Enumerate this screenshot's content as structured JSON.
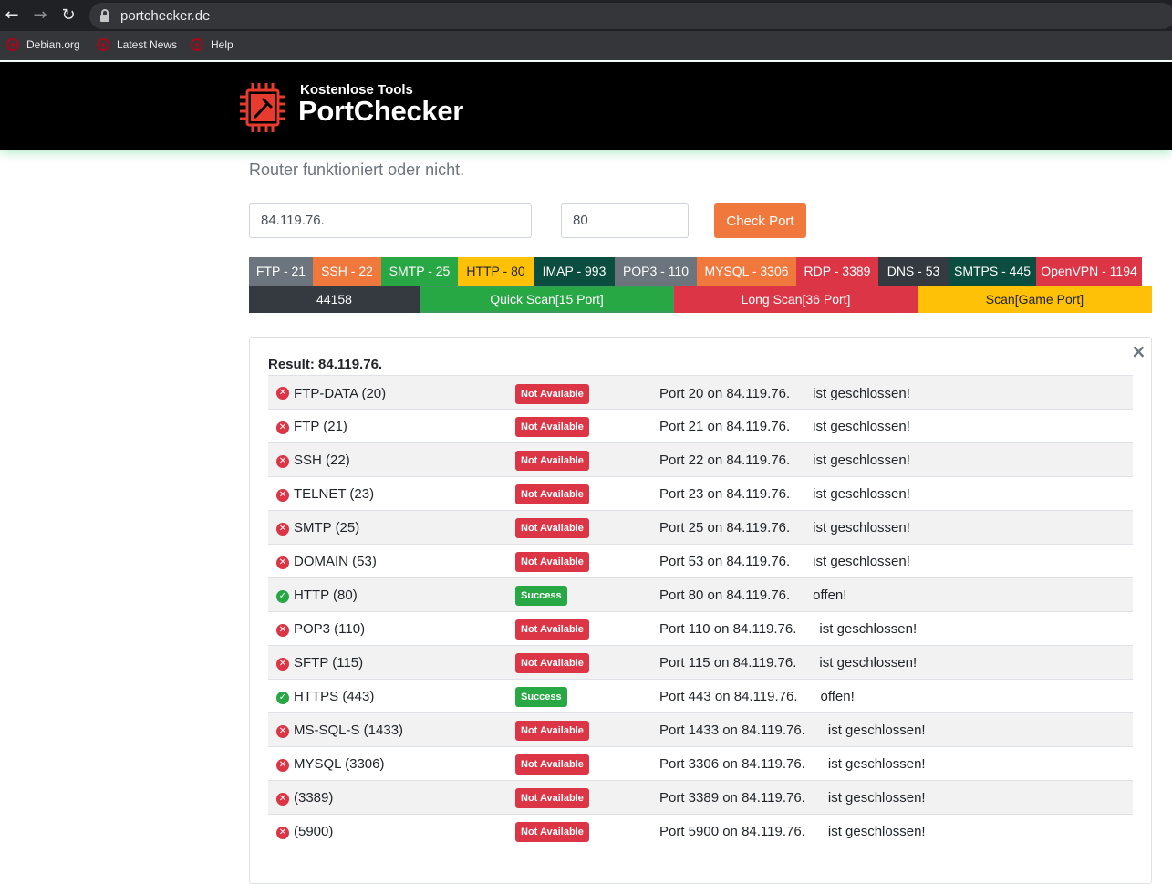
{
  "browser": {
    "url": "portchecker.de",
    "bookmarks": [
      {
        "label": "Debian.org"
      },
      {
        "label": "Latest News"
      },
      {
        "label": "Help"
      }
    ]
  },
  "header": {
    "logo_small": "Kostenlose Tools",
    "logo_big": "PortChecker"
  },
  "intro": {
    "line2": "Router funktioniert oder nicht."
  },
  "form": {
    "ip_value": "84.119.76.",
    "port_value": "80",
    "check_label": "Check Port"
  },
  "quick_ports": [
    {
      "label": "FTP - 21",
      "color": "#6c757d",
      "text": "#ffffff"
    },
    {
      "label": "SSH - 22",
      "color": "#f0783c",
      "text": "#ffffff"
    },
    {
      "label": "SMTP - 25",
      "color": "#28a745",
      "text": "#ffffff"
    },
    {
      "label": "HTTP - 80",
      "color": "#ffc107",
      "text": "#212529"
    },
    {
      "label": "IMAP - 993",
      "color": "#0b4d3f",
      "text": "#ffffff"
    },
    {
      "label": "POP3 - 110",
      "color": "#6c757d",
      "text": "#ffffff"
    },
    {
      "label": "MYSQL - 3306",
      "color": "#f0783c",
      "text": "#ffffff"
    },
    {
      "label": "RDP - 3389",
      "color": "#dc3545",
      "text": "#ffffff"
    },
    {
      "label": "DNS - 53",
      "color": "#343a40",
      "text": "#ffffff"
    },
    {
      "label": "SMTPS - 445",
      "color": "#0b4d3f",
      "text": "#ffffff"
    },
    {
      "label": "OpenVPN - 1194",
      "color": "#dc3545",
      "text": "#ffffff"
    }
  ],
  "scan_buttons": [
    {
      "label": "44158",
      "color": "#343a40",
      "text": "#ffffff"
    },
    {
      "label": "Quick Scan[15 Port]",
      "color": "#28a745",
      "text": "#ffffff"
    },
    {
      "label": "Long Scan[36 Port]",
      "color": "#dc3545",
      "text": "#ffffff"
    },
    {
      "label": "Scan[Game Port]",
      "color": "#ffc107",
      "text": "#212529"
    }
  ],
  "result": {
    "title": "Result: 84.119.76.",
    "close": "×",
    "rows": [
      {
        "service": "FTP-DATA (20)",
        "status": "Not Available",
        "ok": false,
        "message": "Port 20 on 84.119.76.      ist geschlossen!"
      },
      {
        "service": "FTP (21)",
        "status": "Not Available",
        "ok": false,
        "message": "Port 21 on 84.119.76.      ist geschlossen!"
      },
      {
        "service": "SSH (22)",
        "status": "Not Available",
        "ok": false,
        "message": "Port 22 on 84.119.76.      ist geschlossen!"
      },
      {
        "service": "TELNET (23)",
        "status": "Not Available",
        "ok": false,
        "message": "Port 23 on 84.119.76.      ist geschlossen!"
      },
      {
        "service": "SMTP (25)",
        "status": "Not Available",
        "ok": false,
        "message": "Port 25 on 84.119.76.      ist geschlossen!"
      },
      {
        "service": "DOMAIN (53)",
        "status": "Not Available",
        "ok": false,
        "message": "Port 53 on 84.119.76.      ist geschlossen!"
      },
      {
        "service": "HTTP (80)",
        "status": "Success",
        "ok": true,
        "message": "Port 80 on 84.119.76.      offen!"
      },
      {
        "service": "POP3 (110)",
        "status": "Not Available",
        "ok": false,
        "message": "Port 110 on 84.119.76.      ist geschlossen!"
      },
      {
        "service": "SFTP (115)",
        "status": "Not Available",
        "ok": false,
        "message": "Port 115 on 84.119.76.      ist geschlossen!"
      },
      {
        "service": "HTTPS (443)",
        "status": "Success",
        "ok": true,
        "message": "Port 443 on 84.119.76.      offen!"
      },
      {
        "service": "MS-SQL-S (1433)",
        "status": "Not Available",
        "ok": false,
        "message": "Port 1433 on 84.119.76.      ist geschlossen!"
      },
      {
        "service": "MYSQL (3306)",
        "status": "Not Available",
        "ok": false,
        "message": "Port 3306 on 84.119.76.      ist geschlossen!"
      },
      {
        "service": "(3389)",
        "status": "Not Available",
        "ok": false,
        "message": "Port 3389 on 84.119.76.      ist geschlossen!"
      },
      {
        "service": "(5900)",
        "status": "Not Available",
        "ok": false,
        "message": "Port 5900 on 84.119.76.      ist geschlossen!"
      }
    ]
  }
}
